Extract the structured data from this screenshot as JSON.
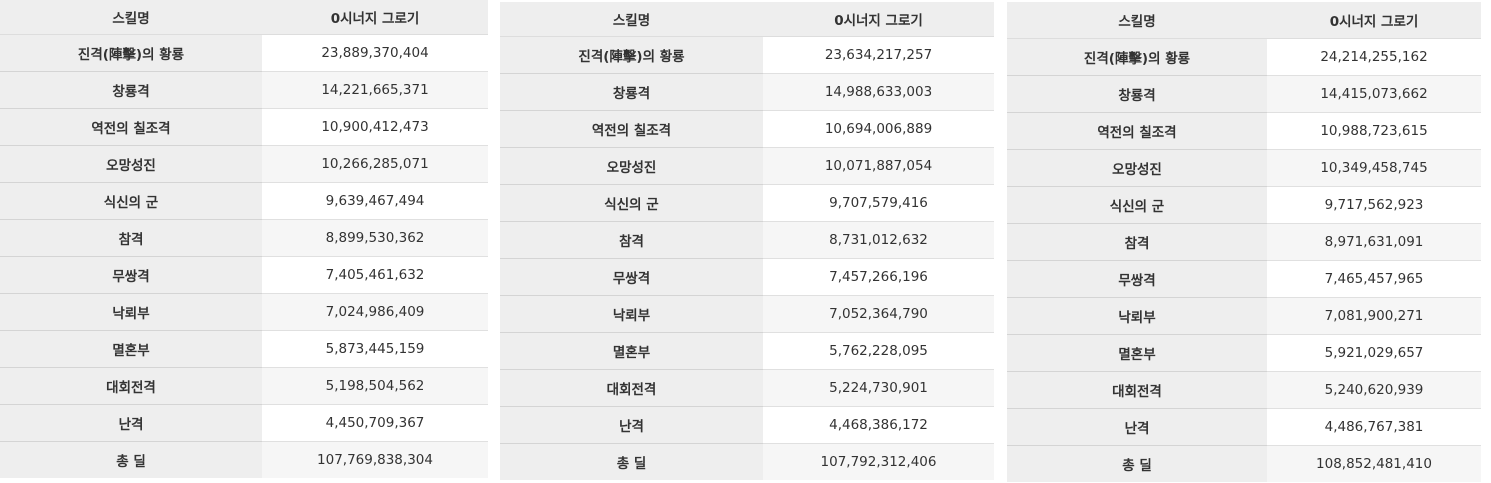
{
  "tables": [
    {
      "header": {
        "skill": "스킬명",
        "value": "0시너지 그로기"
      },
      "rows": [
        {
          "skill": "진격(陣擊)의 황룡",
          "value": "23,889,370,404"
        },
        {
          "skill": "창룡격",
          "value": "14,221,665,371"
        },
        {
          "skill": "역전의 칠조격",
          "value": "10,900,412,473"
        },
        {
          "skill": "오망성진",
          "value": "10,266,285,071"
        },
        {
          "skill": "식신의 군",
          "value": "9,639,467,494"
        },
        {
          "skill": "참격",
          "value": "8,899,530,362"
        },
        {
          "skill": "무쌍격",
          "value": "7,405,461,632"
        },
        {
          "skill": "낙뢰부",
          "value": "7,024,986,409"
        },
        {
          "skill": "멸혼부",
          "value": "5,873,445,159"
        },
        {
          "skill": "대회전격",
          "value": "5,198,504,562"
        },
        {
          "skill": "난격",
          "value": "4,450,709,367"
        },
        {
          "skill": "총 딜",
          "value": "107,769,838,304"
        }
      ]
    },
    {
      "header": {
        "skill": "스킬명",
        "value": "0시너지 그로기"
      },
      "rows": [
        {
          "skill": "진격(陣擊)의 황룡",
          "value": "23,634,217,257"
        },
        {
          "skill": "창룡격",
          "value": "14,988,633,003"
        },
        {
          "skill": "역전의 칠조격",
          "value": "10,694,006,889"
        },
        {
          "skill": "오망성진",
          "value": "10,071,887,054"
        },
        {
          "skill": "식신의 군",
          "value": "9,707,579,416"
        },
        {
          "skill": "참격",
          "value": "8,731,012,632"
        },
        {
          "skill": "무쌍격",
          "value": "7,457,266,196"
        },
        {
          "skill": "낙뢰부",
          "value": "7,052,364,790"
        },
        {
          "skill": "멸혼부",
          "value": "5,762,228,095"
        },
        {
          "skill": "대회전격",
          "value": "5,224,730,901"
        },
        {
          "skill": "난격",
          "value": "4,468,386,172"
        },
        {
          "skill": "총 딜",
          "value": "107,792,312,406"
        }
      ]
    },
    {
      "header": {
        "skill": "스킬명",
        "value": "0시너지 그로기"
      },
      "rows": [
        {
          "skill": "진격(陣擊)의 황룡",
          "value": "24,214,255,162"
        },
        {
          "skill": "창룡격",
          "value": "14,415,073,662"
        },
        {
          "skill": "역전의 칠조격",
          "value": "10,988,723,615"
        },
        {
          "skill": "오망성진",
          "value": "10,349,458,745"
        },
        {
          "skill": "식신의 군",
          "value": "9,717,562,923"
        },
        {
          "skill": "참격",
          "value": "8,971,631,091"
        },
        {
          "skill": "무쌍격",
          "value": "7,465,457,965"
        },
        {
          "skill": "낙뢰부",
          "value": "7,081,900,271"
        },
        {
          "skill": "멸혼부",
          "value": "5,921,029,657"
        },
        {
          "skill": "대회전격",
          "value": "5,240,620,939"
        },
        {
          "skill": "난격",
          "value": "4,486,767,381"
        },
        {
          "skill": "총 딜",
          "value": "108,852,481,410"
        }
      ]
    }
  ]
}
